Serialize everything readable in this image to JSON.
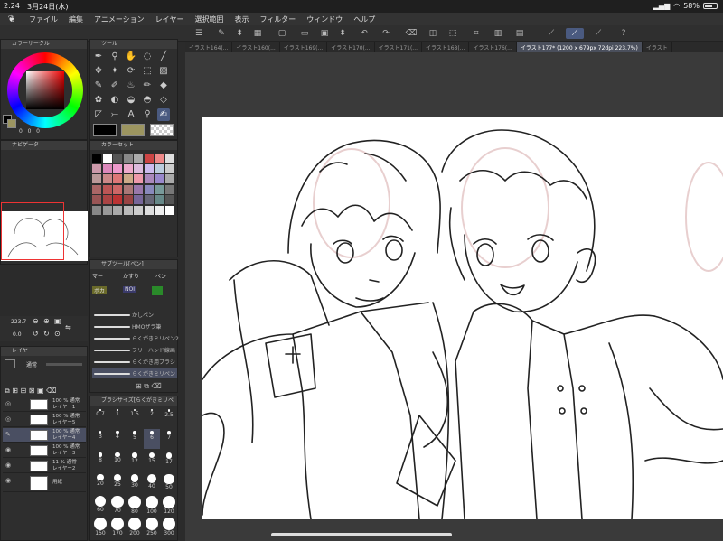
{
  "status": {
    "time": "2:24",
    "date": "3月24日(水)",
    "battery": "58%"
  },
  "menu": [
    "ファイル",
    "編集",
    "アニメーション",
    "レイヤー",
    "選択範囲",
    "表示",
    "フィルター",
    "ウィンドウ",
    "ヘルプ"
  ],
  "tabs": [
    "イラスト164(...",
    "イラスト160(...",
    "イラスト169(...",
    "イラスト170(...",
    "イラスト171(...",
    "イラスト168(...",
    "イラスト176(...",
    "イラスト177* (1200 x 679px 72dpi 223.7%)",
    "イラスト"
  ],
  "panels": {
    "color_circle": "カラーサークル",
    "tool": "ツール",
    "navigator": "ナビゲータ",
    "color_set": "カラーセット",
    "sub_tool": "サブツール[ペン]",
    "layer": "レイヤー",
    "brush_size": "ブラシサイズ[らくがきミリペ"
  },
  "color_values": [
    "0",
    "0",
    "0"
  ],
  "subtool_tabs": [
    "マー",
    "かすり",
    "ペン",
    "ボカ",
    "NOI"
  ],
  "navigator": {
    "zoom": "223.7",
    "angle": "0.0"
  },
  "layer_blend": "通常",
  "brushes": [
    {
      "label": "かしペン"
    },
    {
      "label": "HMOザラ筆"
    },
    {
      "label": "らくがきミリペン2"
    },
    {
      "label": "フリーハンド線画"
    },
    {
      "label": "らくがき用ブラシ"
    },
    {
      "label": "らくがきミリペン"
    }
  ],
  "layers": [
    {
      "opacity": "100 % 通常",
      "name": "レイヤー1"
    },
    {
      "opacity": "100 % 通常",
      "name": "レイヤー5"
    },
    {
      "opacity": "100 % 通常",
      "name": "レイヤー4"
    },
    {
      "opacity": "100 % 通常",
      "name": "レイヤー3"
    },
    {
      "opacity": "11 % 通常",
      "name": "レイヤー2"
    },
    {
      "opacity": "",
      "name": "用紙"
    }
  ],
  "brush_sizes": [
    "0.7",
    "1",
    "1.5",
    "2",
    "2.5",
    "3",
    "4",
    "5",
    "6",
    "7",
    "8",
    "10",
    "12",
    "15",
    "17",
    "20",
    "25",
    "30",
    "40",
    "50",
    "60",
    "70",
    "80",
    "100",
    "120",
    "150",
    "170",
    "200",
    "250",
    "300"
  ],
  "colors": {
    "accent": "#4a5a80",
    "main_color": "#000000",
    "sub_color": "#9c9560",
    "panel": "#2e2e2e"
  }
}
